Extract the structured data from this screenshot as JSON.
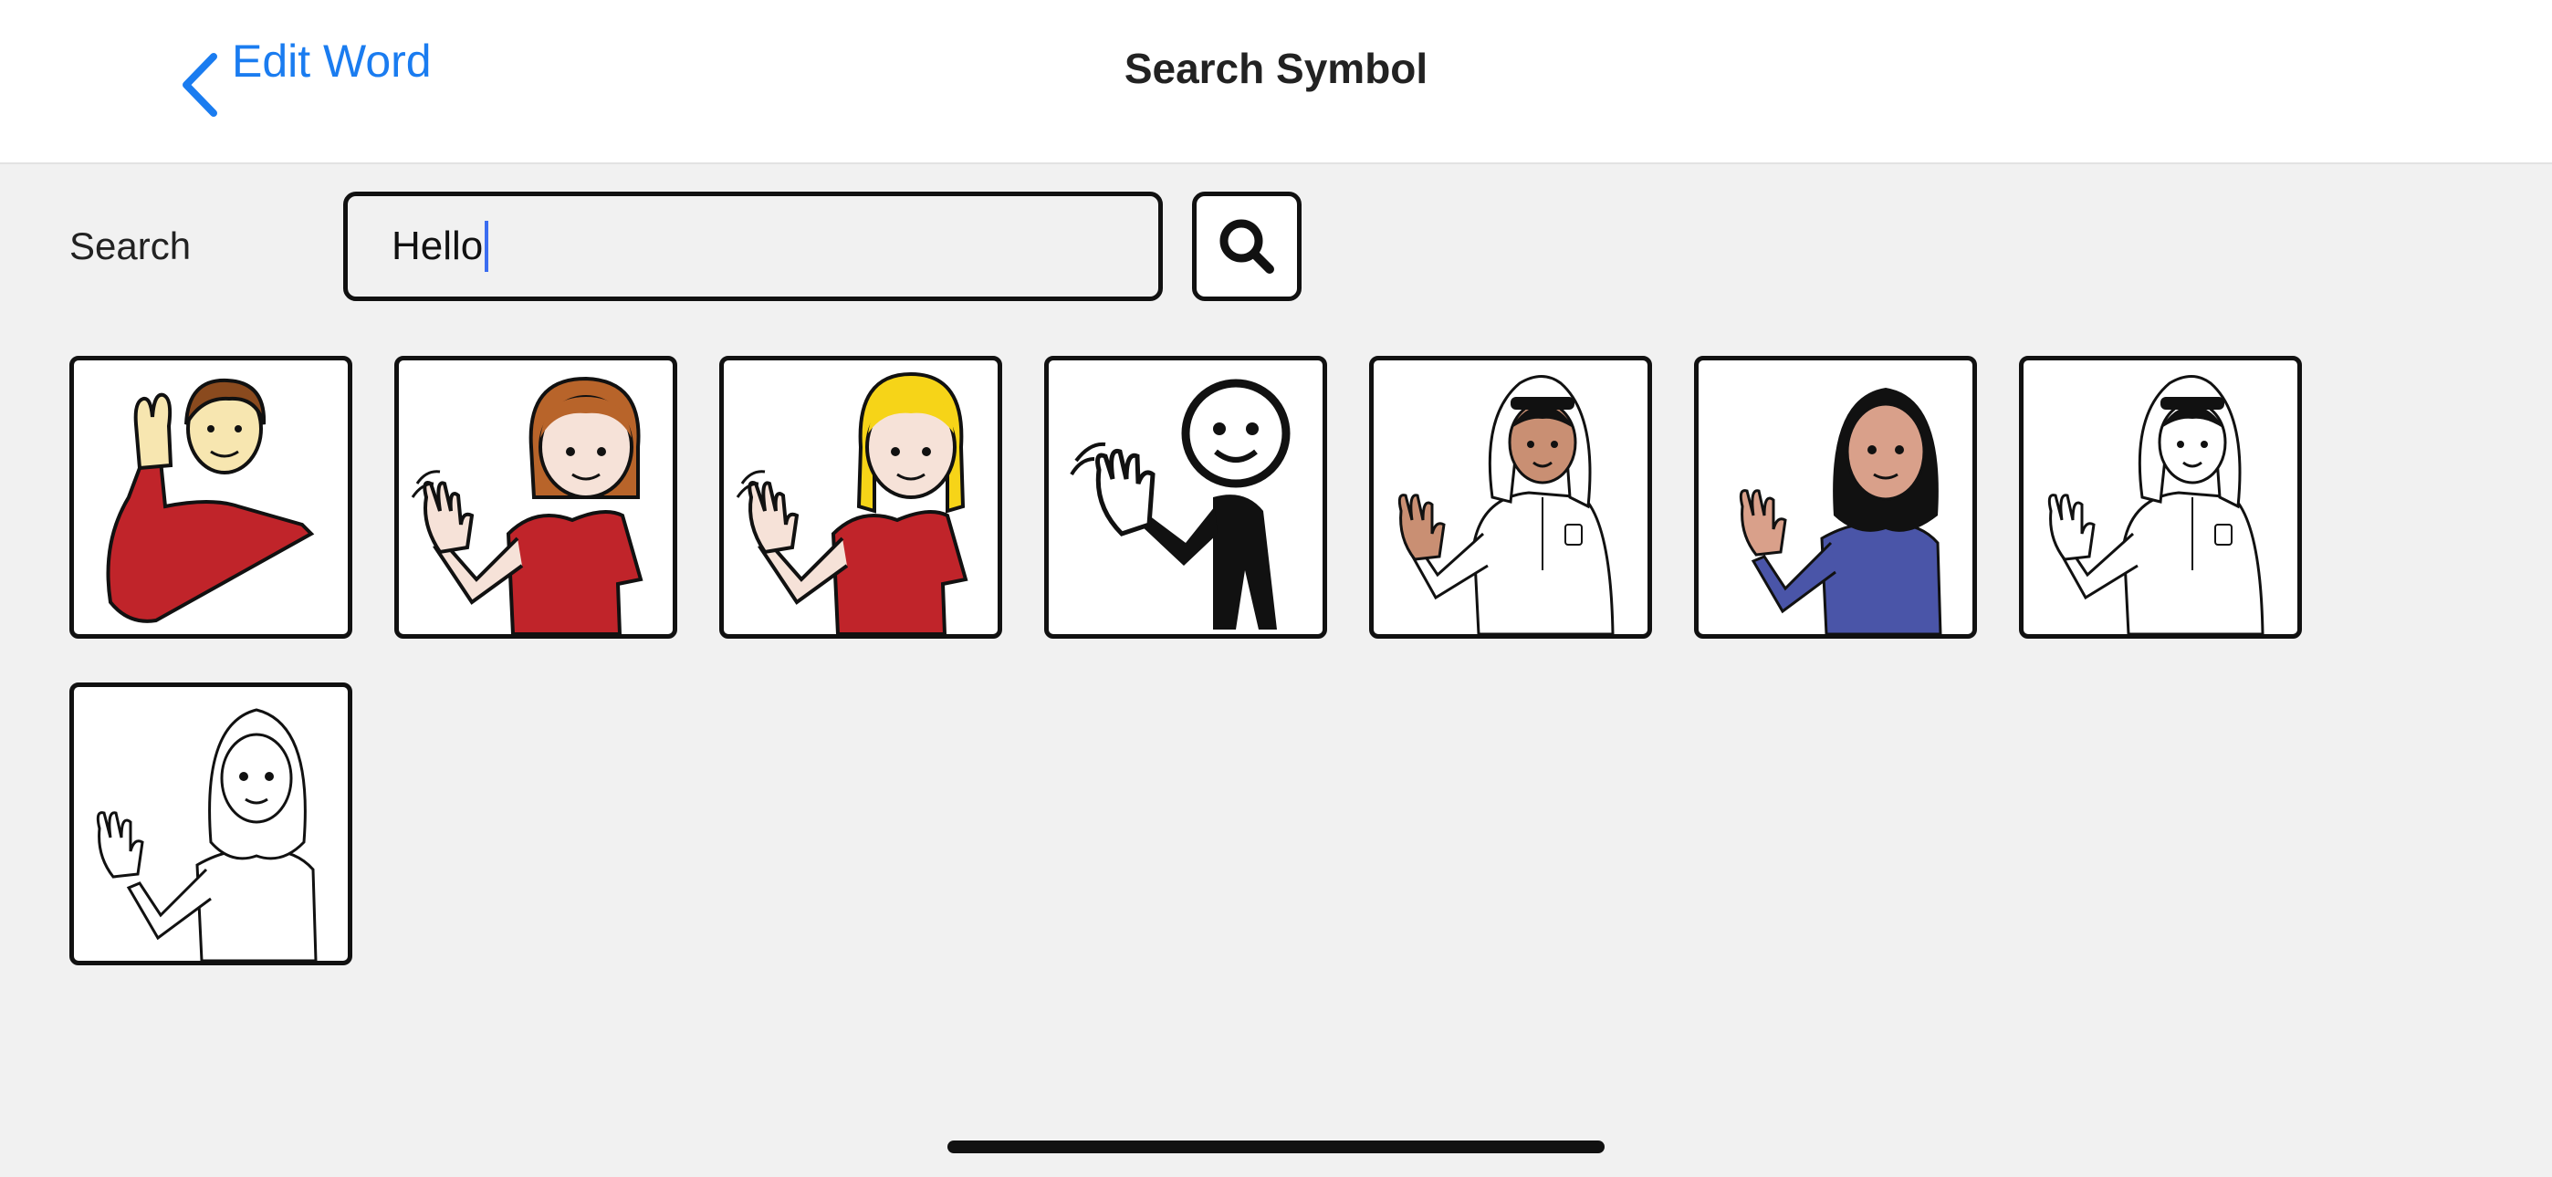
{
  "nav": {
    "back_label": "Edit Word",
    "title": "Search Symbol"
  },
  "search": {
    "label": "Search",
    "value": "Hello",
    "button_icon": "magnifier-icon"
  },
  "symbols": [
    {
      "icon": "man-raising-hand-icon"
    },
    {
      "icon": "girl-waving-brown-hair-icon"
    },
    {
      "icon": "girl-waving-blonde-hair-icon"
    },
    {
      "icon": "stick-figure-waving-icon"
    },
    {
      "icon": "man-in-ghutra-waving-icon"
    },
    {
      "icon": "woman-in-hijab-waving-icon"
    },
    {
      "icon": "man-in-ghutra-waving-outline-icon"
    },
    {
      "icon": "person-in-hood-waving-outline-icon"
    }
  ],
  "colors": {
    "accent": "#1a7cf0",
    "background": "#f1f1f1",
    "navbar": "#ffffff",
    "caret": "#3b6df0"
  }
}
